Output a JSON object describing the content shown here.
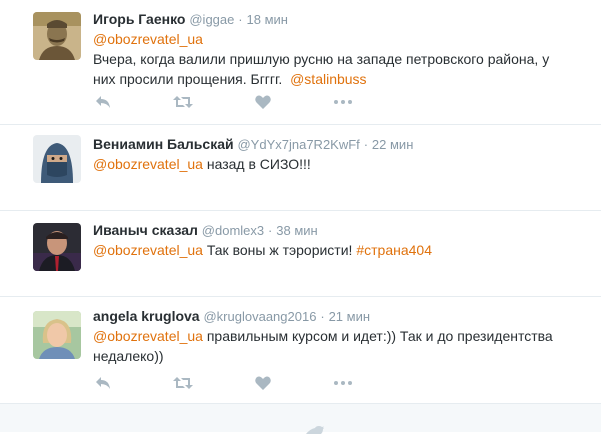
{
  "tweets": [
    {
      "name": "Игорь Гаенко",
      "handle": "@iggae",
      "dot": "·",
      "time": "18 мин",
      "mention": "@obozrevatel_ua",
      "text": "Вчера, когда валили пришлую русню на западе петровского района, у них просили прощения. Бгггг.",
      "tag": "@stalinbuss"
    },
    {
      "name": "Вениамин Бальскай",
      "handle": "@YdYx7jna7R2KwFf",
      "dot": "·",
      "time": "22 мин",
      "mention": "@obozrevatel_ua",
      "text": "назад в СИЗО!!!"
    },
    {
      "name": "Иваныч сказал",
      "handle": "@domlex3",
      "dot": "·",
      "time": "38 мин",
      "mention": "@obozrevatel_ua",
      "text": "Так воны ж тэрористи!",
      "tag": "#страна404"
    },
    {
      "name": "angela kruglova",
      "handle": "@kruglovaang2016",
      "dot": "·",
      "time": "21 мин",
      "mention": "@obozrevatel_ua",
      "text": "правильным курсом и идет:)) Так и до президентства недалеко))"
    }
  ],
  "icons": {
    "reply": "reply-icon",
    "retweet": "retweet-icon",
    "like": "heart-icon",
    "more": "more-icon",
    "footer": "twitter-bird-icon"
  },
  "colors": {
    "link": "#e0720d",
    "icon": "#aab8c2",
    "meta": "#8899a6",
    "divider": "#e6ecf0"
  }
}
